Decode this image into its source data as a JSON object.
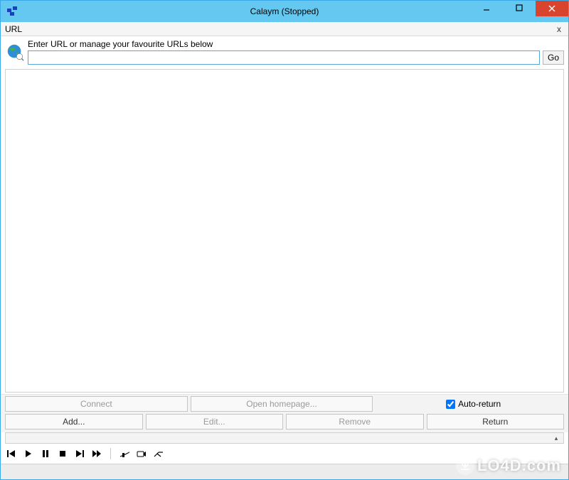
{
  "window": {
    "title": "Calaym (Stopped)"
  },
  "subheader": {
    "title": "URL",
    "close_glyph": "x"
  },
  "url": {
    "hint": "Enter URL or manage your favourite URLs below",
    "value": "",
    "go_label": "Go"
  },
  "actions": {
    "row1": {
      "connect": "Connect",
      "open_homepage": "Open homepage...",
      "auto_return_label": "Auto-return",
      "auto_return_checked": true
    },
    "row2": {
      "add": "Add...",
      "edit": "Edit...",
      "remove": "Remove",
      "return": "Return"
    }
  },
  "scrollhint": {
    "arrow": "▴"
  },
  "watermark": {
    "text": "LO4D.com"
  }
}
